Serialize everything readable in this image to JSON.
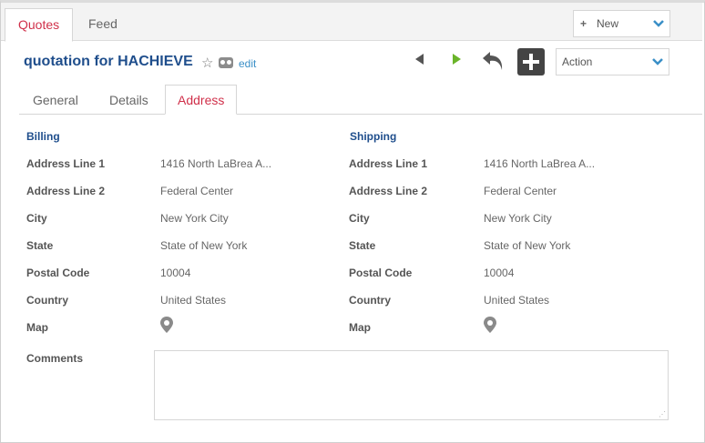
{
  "top_tabs": [
    {
      "label": "Quotes",
      "active": true
    },
    {
      "label": "Feed",
      "active": false
    }
  ],
  "new_menu": {
    "label": "New",
    "icon": "plus-icon"
  },
  "record": {
    "title": "quotation for HACHIEVE",
    "edit_label": "edit"
  },
  "action_menu": {
    "label": "Action"
  },
  "sub_tabs": [
    {
      "label": "General",
      "active": false
    },
    {
      "label": "Details",
      "active": false
    },
    {
      "label": "Address",
      "active": true
    }
  ],
  "billing": {
    "heading": "Billing",
    "fields": [
      {
        "label": "Address Line 1",
        "value": "1416 North LaBrea A..."
      },
      {
        "label": "Address Line 2",
        "value": "Federal Center"
      },
      {
        "label": "City",
        "value": "New York City"
      },
      {
        "label": "State",
        "value": "State of New York"
      },
      {
        "label": "Postal Code",
        "value": "10004"
      },
      {
        "label": "Country",
        "value": "United States"
      },
      {
        "label": "Map",
        "icon": "map-pin-icon"
      }
    ]
  },
  "shipping": {
    "heading": "Shipping",
    "fields": [
      {
        "label": "Address Line 1",
        "value": "1416 North LaBrea A..."
      },
      {
        "label": "Address Line 2",
        "value": "Federal Center"
      },
      {
        "label": "City",
        "value": "New York City"
      },
      {
        "label": "State",
        "value": "State of New York"
      },
      {
        "label": "Postal Code",
        "value": "10004"
      },
      {
        "label": "Country",
        "value": "United States"
      },
      {
        "label": "Map",
        "icon": "map-pin-icon"
      }
    ]
  },
  "comments": {
    "label": "Comments",
    "value": ""
  },
  "colors": {
    "accent_red": "#d0304a",
    "title_blue": "#1f4e8c",
    "link_blue": "#3a8fc7",
    "next_green": "#6ab42a"
  }
}
